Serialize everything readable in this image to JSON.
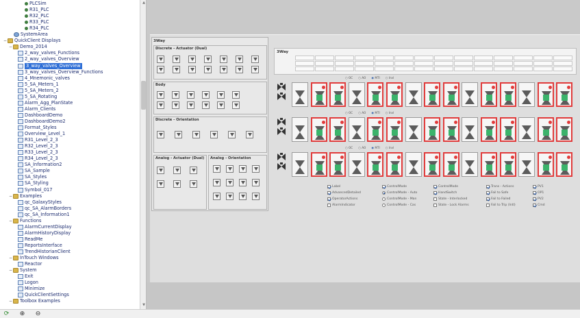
{
  "tree": {
    "items": [
      {
        "label": "PLCSim",
        "kind": "dot"
      },
      {
        "label": "R31_PLC",
        "kind": "dot"
      },
      {
        "label": "R32_PLC",
        "kind": "dot"
      },
      {
        "label": "R33_PLC",
        "kind": "dot"
      },
      {
        "label": "R34_PLC",
        "kind": "dot"
      },
      {
        "label": "SystemArea",
        "kind": "area"
      },
      {
        "label": "QuickClient Displays",
        "kind": "folder"
      },
      {
        "label": "Demo_2014",
        "kind": "folder"
      },
      {
        "label": "2_way_valves_Functions",
        "kind": "disp"
      },
      {
        "label": "2_way_valves_Overview",
        "kind": "disp"
      },
      {
        "label": "3_way_valves_Overview",
        "kind": "disp",
        "selected": true
      },
      {
        "label": "3_way_valves_Overview_Functions",
        "kind": "disp"
      },
      {
        "label": "4_Mnemonic_valves",
        "kind": "disp"
      },
      {
        "label": "5_SA_Meters_1",
        "kind": "disp"
      },
      {
        "label": "5_SA_Meters_2",
        "kind": "disp"
      },
      {
        "label": "5_SA_Rotating",
        "kind": "disp"
      },
      {
        "label": "Alarm_Agg_PlanState",
        "kind": "disp"
      },
      {
        "label": "Alarm_Clients",
        "kind": "disp"
      },
      {
        "label": "DashboardDemo",
        "kind": "disp"
      },
      {
        "label": "DashboardDemo2",
        "kind": "disp"
      },
      {
        "label": "Format_Styles",
        "kind": "disp"
      },
      {
        "label": "Overview_Level_1",
        "kind": "disp"
      },
      {
        "label": "R31_Level_2_3",
        "kind": "disp"
      },
      {
        "label": "R32_Level_2_3",
        "kind": "disp"
      },
      {
        "label": "R33_Level_2_3",
        "kind": "disp"
      },
      {
        "label": "R34_Level_2_3",
        "kind": "disp"
      },
      {
        "label": "SA_Information2",
        "kind": "disp"
      },
      {
        "label": "SA_Sample",
        "kind": "disp"
      },
      {
        "label": "SA_Styles",
        "kind": "disp"
      },
      {
        "label": "SA_Styling",
        "kind": "disp"
      },
      {
        "label": "Symbol_017",
        "kind": "disp"
      },
      {
        "label": "Examples",
        "kind": "folder"
      },
      {
        "label": "qc_GalaxyStyles",
        "kind": "disp"
      },
      {
        "label": "qc_SA_AlarmBorders",
        "kind": "disp"
      },
      {
        "label": "qc_SA_Information1",
        "kind": "disp"
      },
      {
        "label": "Functions",
        "kind": "folder"
      },
      {
        "label": "AlarmCurrentDisplay",
        "kind": "disp"
      },
      {
        "label": "AlarmHistoryDisplay",
        "kind": "disp"
      },
      {
        "label": "ReadMe",
        "kind": "disp"
      },
      {
        "label": "ReportsInterface",
        "kind": "disp"
      },
      {
        "label": "TrendHistorianClient",
        "kind": "disp"
      },
      {
        "label": "InTouch Windows",
        "kind": "folder"
      },
      {
        "label": "Reactor",
        "kind": "disp"
      },
      {
        "label": "System",
        "kind": "folder"
      },
      {
        "label": "Exit",
        "kind": "disp"
      },
      {
        "label": "Logon",
        "kind": "disp"
      },
      {
        "label": "Minimize",
        "kind": "disp"
      },
      {
        "label": "QuickClientSettings",
        "kind": "disp"
      },
      {
        "label": "Toolbox Examples",
        "kind": "folder"
      }
    ]
  },
  "canvas": {
    "panel_title": "3Way",
    "groups": {
      "discrete": "Discrete - Actuator (Dual)",
      "body": "Body",
      "orientation": "Discrete - Orientation",
      "analog": "Analog - Actuator (Dual)",
      "analog_orient": "Analog - Orientation"
    },
    "table_title": "3Way",
    "radio_options": [
      "OC",
      "AO",
      "MTI",
      "Invl"
    ],
    "legend": [
      {
        "label": "Label",
        "on": true,
        "type": "check"
      },
      {
        "label": "AdvancedDetailed",
        "on": true,
        "type": "check"
      },
      {
        "label": "OperatorActions",
        "on": true,
        "type": "check"
      },
      {
        "label": "AlarmIndicator",
        "on": false,
        "type": "check"
      },
      {
        "label": "ControlMode",
        "on": true,
        "type": "check"
      },
      {
        "label": "ControlMode - Auto",
        "on": true,
        "type": "radio"
      },
      {
        "label": "ControlMode - Man",
        "on": false,
        "type": "radio"
      },
      {
        "label": "ControlMode - Cas",
        "on": false,
        "type": "radio"
      },
      {
        "label": "ControlMode",
        "on": true,
        "type": "check"
      },
      {
        "label": "HandSwitch",
        "on": true,
        "type": "check"
      },
      {
        "label": "State - Interlocked",
        "on": false,
        "type": "check"
      },
      {
        "label": "State - Lock Alarms",
        "on": false,
        "type": "check"
      },
      {
        "label": "Trans - Actions",
        "on": true,
        "type": "check"
      },
      {
        "label": "Fail to Safe",
        "on": true,
        "type": "check"
      },
      {
        "label": "Fail to Failed",
        "on": true,
        "type": "check"
      },
      {
        "label": "Fail to Trip (Intl)",
        "on": false,
        "type": "check"
      },
      {
        "label": "PV1",
        "on": true,
        "type": "check"
      },
      {
        "label": "OP1",
        "on": true,
        "type": "check"
      },
      {
        "label": "PV2",
        "on": true,
        "type": "check"
      },
      {
        "label": "Cmd",
        "on": true,
        "type": "check"
      }
    ]
  },
  "statusbar": {
    "buttons": [
      {
        "name": "refresh-icon",
        "glyph": "⟳"
      },
      {
        "name": "zoom-in-icon",
        "glyph": "⊕"
      },
      {
        "name": "zoom-out-icon",
        "glyph": "⊖"
      }
    ]
  }
}
